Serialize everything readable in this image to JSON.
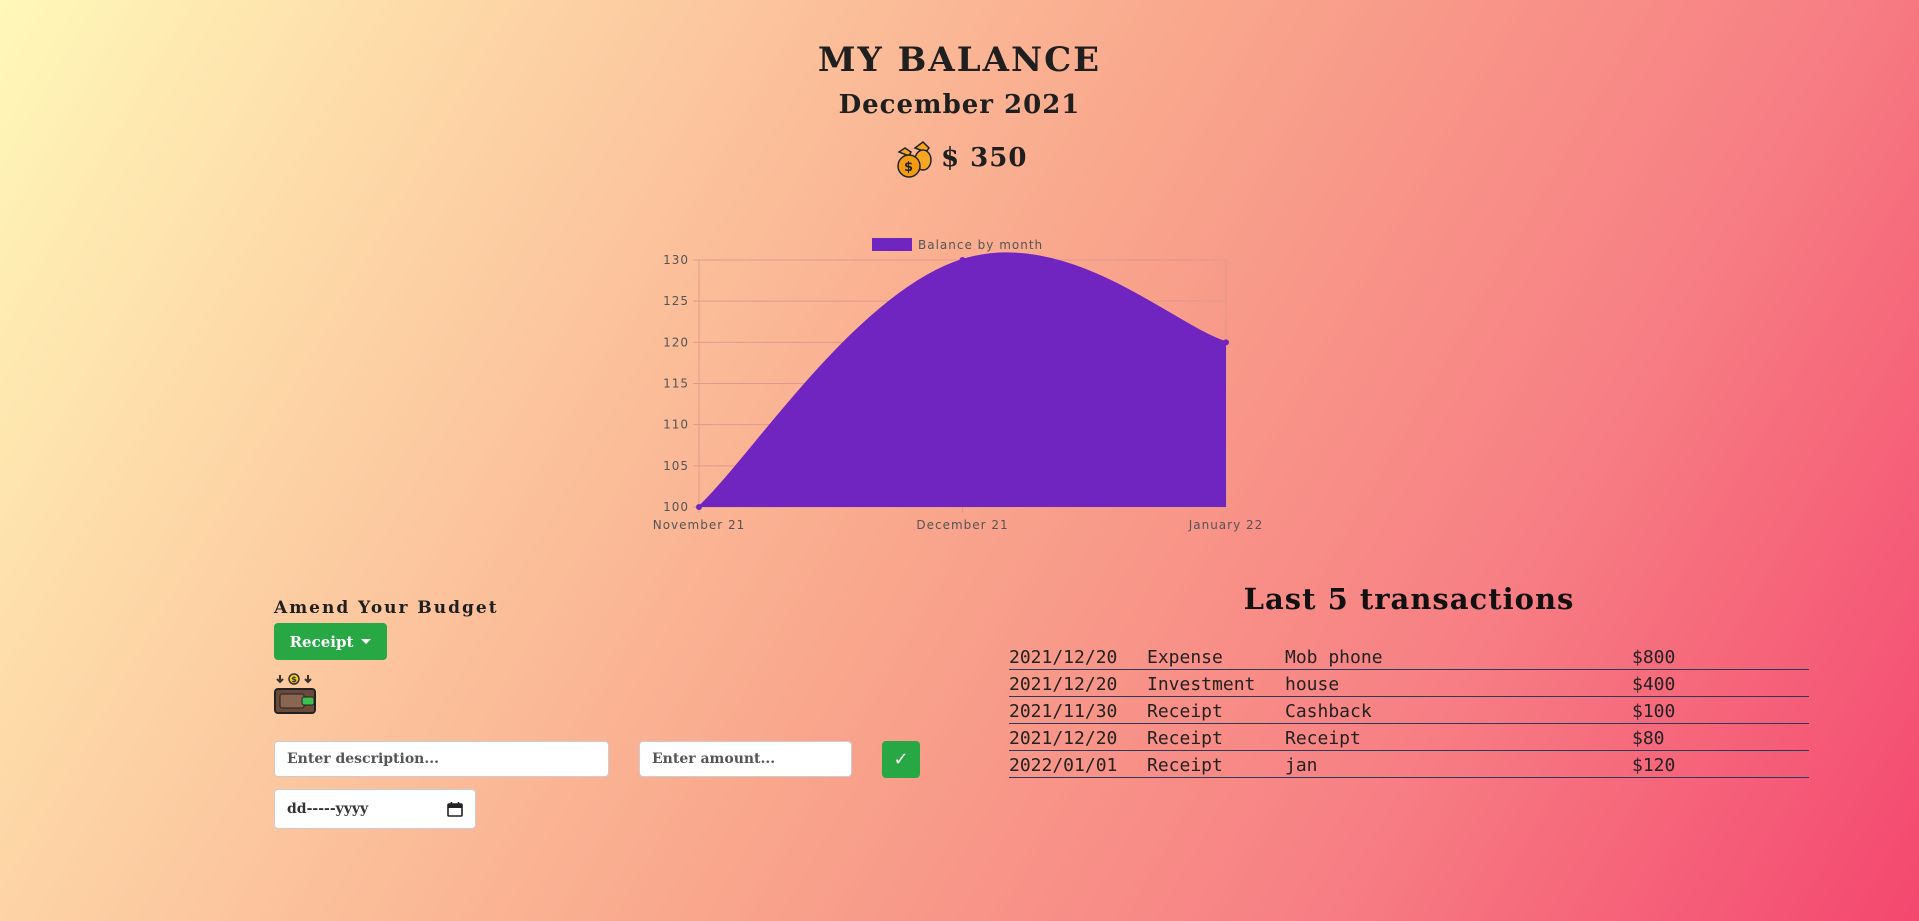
{
  "header": {
    "title": "MY BALANCE",
    "month": "December 2021",
    "balance": "$ 350",
    "balance_icon": "money-bags-icon"
  },
  "chart_data": {
    "type": "area",
    "categories": [
      "November 21",
      "December 21",
      "January 22"
    ],
    "series": [
      {
        "name": "Balance by month",
        "values": [
          100,
          130,
          120
        ],
        "color": "#7024c0"
      }
    ],
    "ylim": [
      100,
      130
    ],
    "yticks": [
      100,
      105,
      110,
      115,
      120,
      125,
      130
    ],
    "legend": "top",
    "grid": true
  },
  "budget": {
    "title": "Amend Your Budget",
    "type_label": "Receipt",
    "icon": "wallet-icon",
    "description_placeholder": "Enter description...",
    "amount_placeholder": "Enter amount...",
    "submit_label": "✓",
    "date_placeholder": "dd-----yyyy",
    "accent": "#28a745"
  },
  "transactions": {
    "title": "Last 5 transactions",
    "rows": [
      {
        "date": "2021/12/20",
        "type": "Expense",
        "description": "Mob phone",
        "amount": "$800"
      },
      {
        "date": "2021/12/20",
        "type": "Investment",
        "description": "house",
        "amount": "$400"
      },
      {
        "date": "2021/11/30",
        "type": "Receipt",
        "description": "Cashback",
        "amount": "$100"
      },
      {
        "date": "2021/12/20",
        "type": "Receipt",
        "description": "Receipt",
        "amount": "$80"
      },
      {
        "date": "2022/01/01",
        "type": "Receipt",
        "description": "jan",
        "amount": "$120"
      }
    ]
  }
}
